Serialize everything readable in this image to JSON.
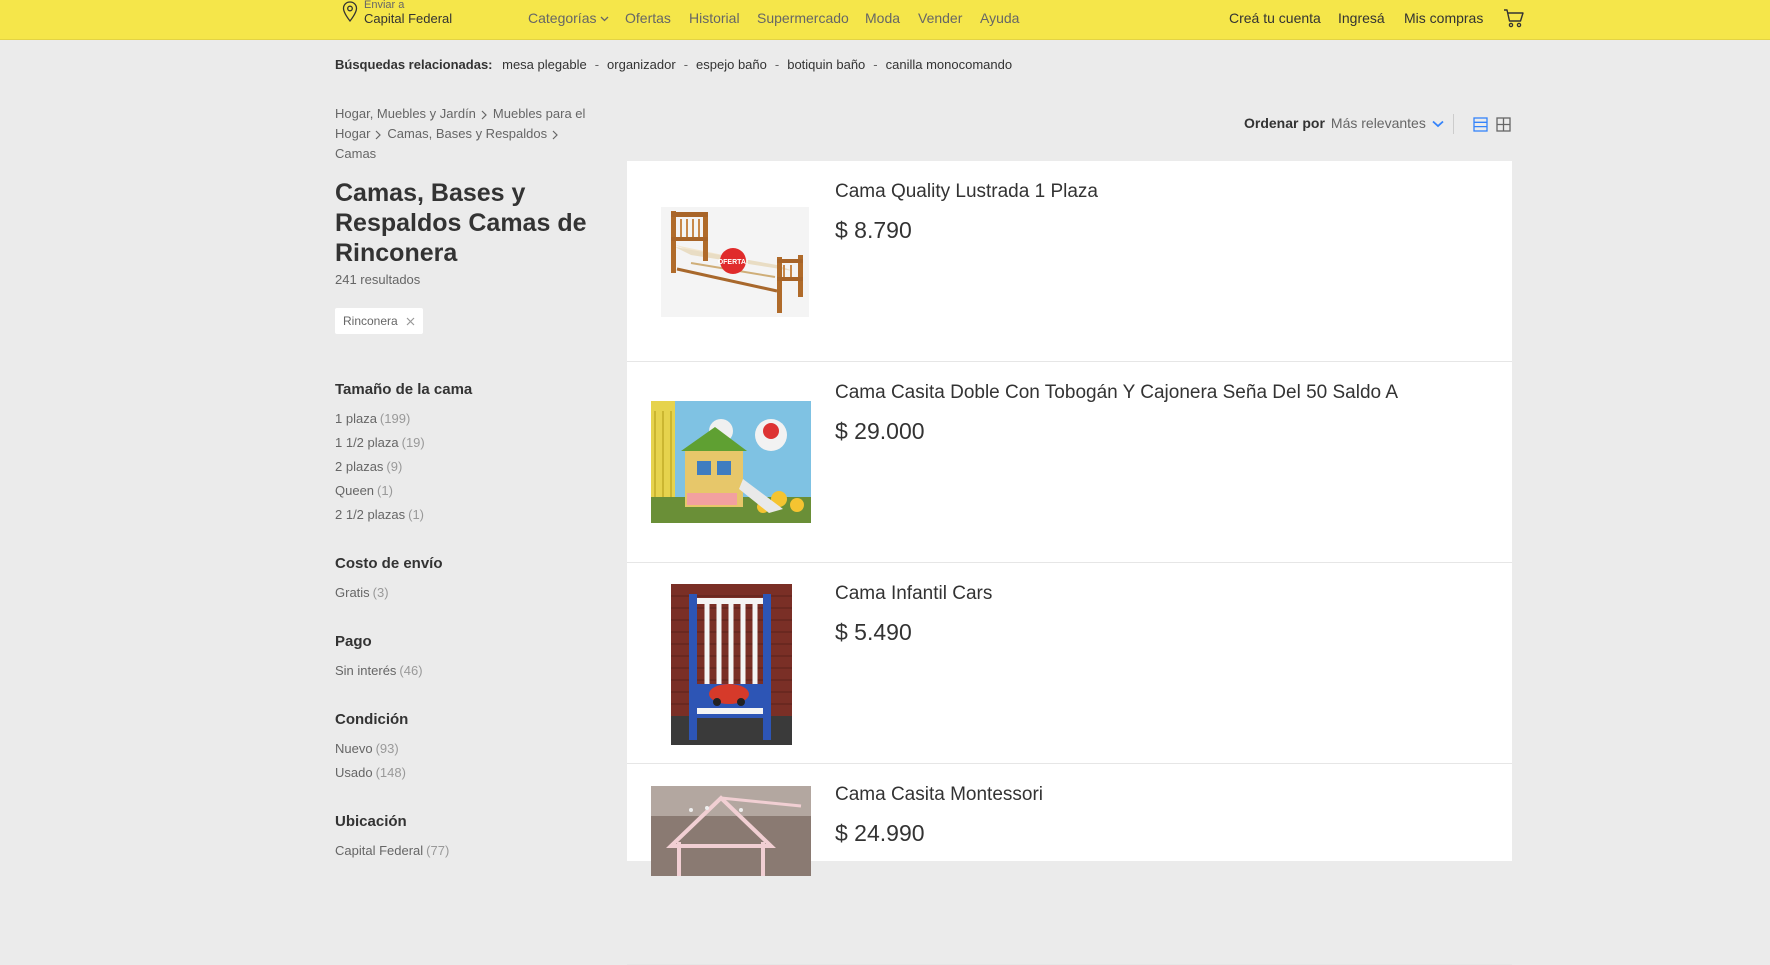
{
  "header": {
    "ship_small": "Enviar a",
    "ship_location": "Capital Federal",
    "nav": [
      "Categorías",
      "Ofertas",
      "Historial",
      "Supermercado",
      "Moda",
      "Vender",
      "Ayuda"
    ],
    "account": [
      "Creá tu cuenta",
      "Ingresá",
      "Mis compras"
    ]
  },
  "related": {
    "label": "Búsquedas relacionadas:",
    "items": [
      "mesa plegable",
      "organizador",
      "espejo baño",
      "botiquin baño",
      "canilla monocomando"
    ]
  },
  "breadcrumb": [
    "Hogar, Muebles y Jardín",
    "Muebles para el Hogar",
    "Camas, Bases y Respaldos",
    "Camas"
  ],
  "title": "Camas, Bases y Respaldos Camas de Rinconera",
  "results_count": "241 resultados",
  "active_filter": "Rinconera",
  "filters": [
    {
      "title": "Tamaño de la cama",
      "items": [
        {
          "label": "1 plaza",
          "count": "(199)"
        },
        {
          "label": "1 1/2 plaza",
          "count": "(19)"
        },
        {
          "label": "2 plazas",
          "count": "(9)"
        },
        {
          "label": "Queen",
          "count": "(1)"
        },
        {
          "label": "2 1/2 plazas",
          "count": "(1)"
        }
      ]
    },
    {
      "title": "Costo de envío",
      "items": [
        {
          "label": "Gratis",
          "count": "(3)"
        }
      ]
    },
    {
      "title": "Pago",
      "items": [
        {
          "label": "Sin interés",
          "count": "(46)"
        }
      ]
    },
    {
      "title": "Condición",
      "items": [
        {
          "label": "Nuevo",
          "count": "(93)"
        },
        {
          "label": "Usado",
          "count": "(148)"
        }
      ]
    },
    {
      "title": "Ubicación",
      "items": [
        {
          "label": "Capital Federal",
          "count": "(77)"
        }
      ]
    }
  ],
  "sort": {
    "label": "Ordenar por",
    "value": "Más relevantes"
  },
  "products": [
    {
      "title": "Cama Quality Lustrada 1 Plaza",
      "price": "$ 8.790",
      "badge": "OFERTA!"
    },
    {
      "title": "Cama Casita Doble Con Tobogán Y Cajonera Seña Del 50 Saldo A",
      "price": "$ 29.000"
    },
    {
      "title": "Cama Infantil Cars",
      "price": "$ 5.490"
    },
    {
      "title": "Cama Casita Montessori",
      "price": "$ 24.990"
    }
  ],
  "colors": {
    "header_bg": "#f5e64a",
    "accent_blue": "#3483fa",
    "page_bg": "#ebebeb"
  }
}
